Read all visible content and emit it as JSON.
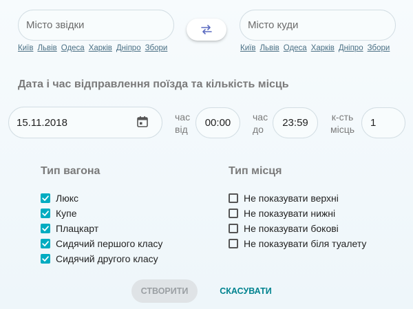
{
  "route": {
    "from_placeholder": "Місто звідки",
    "to_placeholder": "Місто куди",
    "quick_cities_from": [
      "Київ",
      "Львів",
      "Одеса",
      "Харків",
      "Дніпро",
      "Збори"
    ],
    "quick_cities_to": [
      "Київ",
      "Львів",
      "Одеса",
      "Харків",
      "Дніпро",
      "Збори"
    ],
    "swap_icon": "swap-horizontal-icon"
  },
  "datetime": {
    "title": "Дата і час відправлення поїзда та кількість місць",
    "date_value": "15.11.2018",
    "calendar_icon": "calendar-icon",
    "time_from_label": [
      "час",
      "від"
    ],
    "time_from_value": "00:00",
    "time_to_label": [
      "час",
      "до"
    ],
    "time_to_value": "23:59",
    "count_label": [
      "к-сть",
      "місць"
    ],
    "count_value": "1"
  },
  "wagon_type": {
    "title": "Тип вагона",
    "options": [
      {
        "label": "Люкс",
        "checked": true
      },
      {
        "label": "Купе",
        "checked": true
      },
      {
        "label": "Плацкарт",
        "checked": true
      },
      {
        "label": "Сидячий першого класу",
        "checked": true
      },
      {
        "label": "Сидячий другого класу",
        "checked": true
      }
    ]
  },
  "seat_type": {
    "title": "Тип місця",
    "options": [
      {
        "label": "Не показувати верхні",
        "checked": false
      },
      {
        "label": "Не показувати нижні",
        "checked": false
      },
      {
        "label": "Не показувати бокові",
        "checked": false
      },
      {
        "label": "Не показувати біля туалету",
        "checked": false
      }
    ]
  },
  "actions": {
    "create_label": "СТВОРИТИ",
    "cancel_label": "СКАСУВАТИ"
  },
  "colors": {
    "accent": "#00acc1",
    "link": "#00838f",
    "swap_icon": "#5b6bc0"
  }
}
